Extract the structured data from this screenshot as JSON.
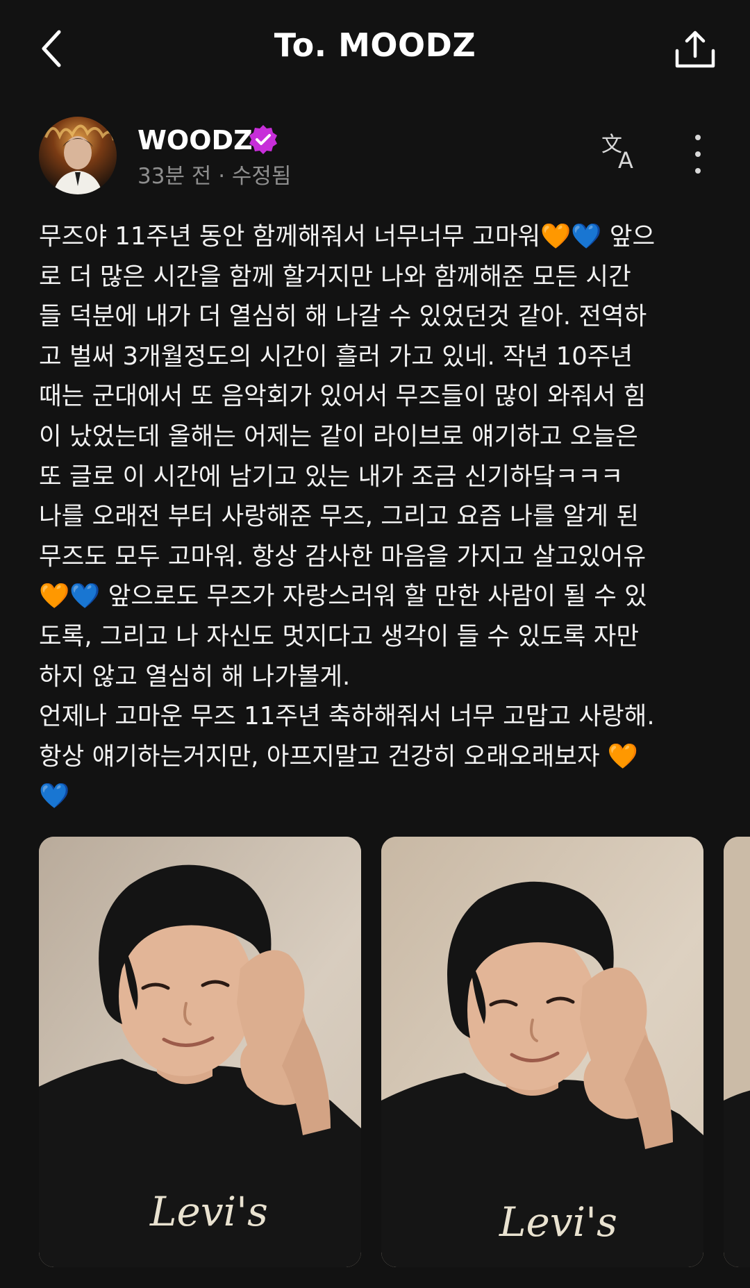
{
  "header": {
    "title": "To. MOODZ",
    "back_icon": "chevron-left-icon",
    "share_icon": "share-icon"
  },
  "author": {
    "name": "WOODZ",
    "meta": "33분 전 · 수정됨",
    "verified_color": "#c72ed9"
  },
  "post": {
    "lines": [
      "무즈야 11주년 동안 함께해줘서 너무너무 고마워🧡💙 앞으",
      "로 더 많은 시간을 함께 할거지만 나와 함께해준 모든 시간",
      "들 덕분에 내가 더 열심히 해 나갈 수 있었던것 같아. 전역하",
      "고 벌써 3개월정도의 시간이 흘러 가고 있네. 작년 10주년",
      "때는 군대에서 또 음악회가 있어서 무즈들이 많이 와줘서 힘",
      "이 났었는데 올해는 어제는 같이 라이브로 얘기하고 오늘은",
      "또 글로 이 시간에 남기고 있는 내가 조금 신기하닼ㅋㅋㅋ",
      "나를 오래전 부터 사랑해준 무즈, 그리고 요즘 나를 알게 된",
      "무즈도 모두 고마워. 항상 감사한 마음을 가지고 살고있어유",
      "🧡💙 앞으로도 무즈가 자랑스러워 할 만한 사람이 될 수 있",
      "도록, 그리고 나 자신도 멋지다고 생각이 들 수 있도록 자만",
      "하지 않고 열심히 해 나가볼게.",
      "언제나 고마운 무즈 11주년 축하해줘서 너무 고맙고 사랑해.",
      "항상 얘기하는거지만, 아프지말고 건강히 오래오래보자 🧡",
      "💙"
    ]
  },
  "photos": {
    "shirt_text": "Levi's"
  },
  "colors": {
    "background": "#121212",
    "text": "#f2f2f2",
    "meta": "#8e8e8e"
  }
}
